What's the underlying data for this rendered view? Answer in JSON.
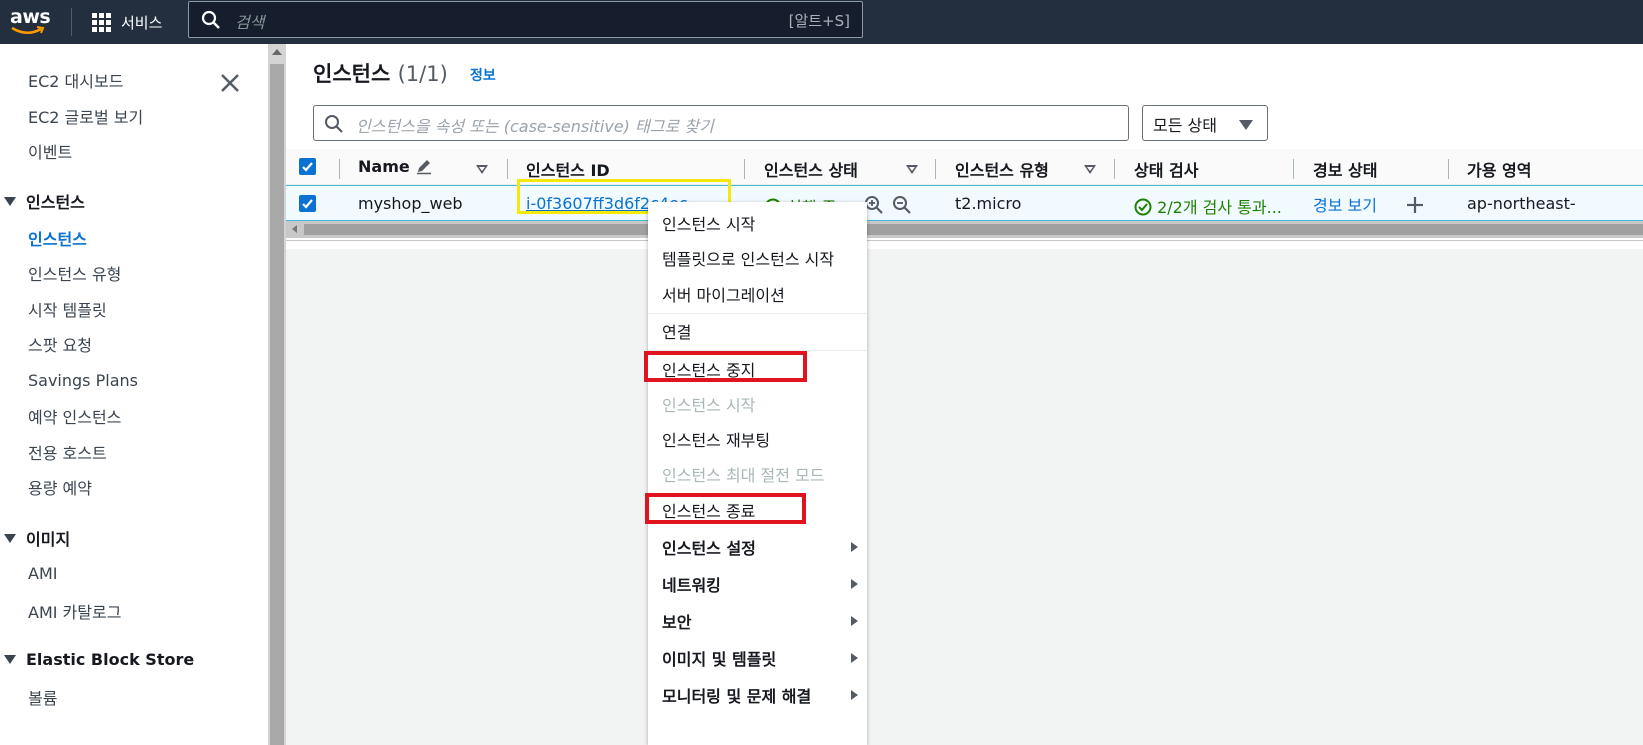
{
  "topbar": {
    "logo": "aws",
    "services_label": "서비스",
    "search_placeholder": "검색",
    "search_shortcut": "[알트+S]"
  },
  "sidebar": {
    "items": [
      {
        "label": "EC2 대시보드"
      },
      {
        "label": "EC2 글로벌 보기"
      },
      {
        "label": "이벤트"
      }
    ],
    "sections": [
      {
        "title": "인스턴스",
        "items": [
          "인스턴스",
          "인스턴스 유형",
          "시작 템플릿",
          "스팟 요청",
          "Savings Plans",
          "예약 인스턴스",
          "전용 호스트",
          "용량 예약"
        ]
      },
      {
        "title": "이미지",
        "items": [
          "AMI",
          "AMI 카탈로그"
        ]
      },
      {
        "title": "Elastic Block Store",
        "items": [
          "볼륨"
        ]
      }
    ],
    "active_item": "인스턴스"
  },
  "main": {
    "title": "인스턴스",
    "count": "(1/1)",
    "info_link": "정보",
    "filter_placeholder": "인스턴스을 속성 또는 (case-sensitive) 태그로 찾기",
    "state_filter": "모든 상태",
    "columns": [
      "Name",
      "인스턴스 ID",
      "인스턴스 상태",
      "인스턴스 유형",
      "상태 검사",
      "경보 상태",
      "가용 영역"
    ],
    "row": {
      "name": "myshop_web",
      "instance_id": "i-0f3607ff3d6f2c4ec",
      "state": "실행 중",
      "type": "t2.micro",
      "status_check": "2/2개 검사 통과...",
      "alarm": "경보 보기",
      "zone": "ap-northeast-"
    }
  },
  "context_menu": {
    "items": [
      {
        "label": "인스턴스 시작",
        "enabled": true
      },
      {
        "label": "템플릿으로 인스턴스 시작",
        "enabled": true
      },
      {
        "label": "서버 마이그레이션",
        "enabled": true
      },
      {
        "label": "연결",
        "enabled": true
      },
      {
        "label": "인스턴스 중지",
        "enabled": true,
        "highlighted": true
      },
      {
        "label": "인스턴스 시작",
        "enabled": false
      },
      {
        "label": "인스턴스 재부팅",
        "enabled": true
      },
      {
        "label": "인스턴스 최대 절전 모드",
        "enabled": false
      },
      {
        "label": "인스턴스 종료",
        "enabled": true,
        "highlighted": true
      },
      {
        "label": "인스턴스 설정",
        "submenu": true
      },
      {
        "label": "네트워킹",
        "submenu": true
      },
      {
        "label": "보안",
        "submenu": true
      },
      {
        "label": "이미지 및 템플릿",
        "submenu": true
      },
      {
        "label": "모니터링 및 문제 해결",
        "submenu": true
      }
    ]
  },
  "colors": {
    "topbar_bg": "#232f3e",
    "accent": "#0972d3",
    "success": "#1d8102",
    "highlight_yellow": "#f5e80a",
    "highlight_red": "#e0141e"
  }
}
